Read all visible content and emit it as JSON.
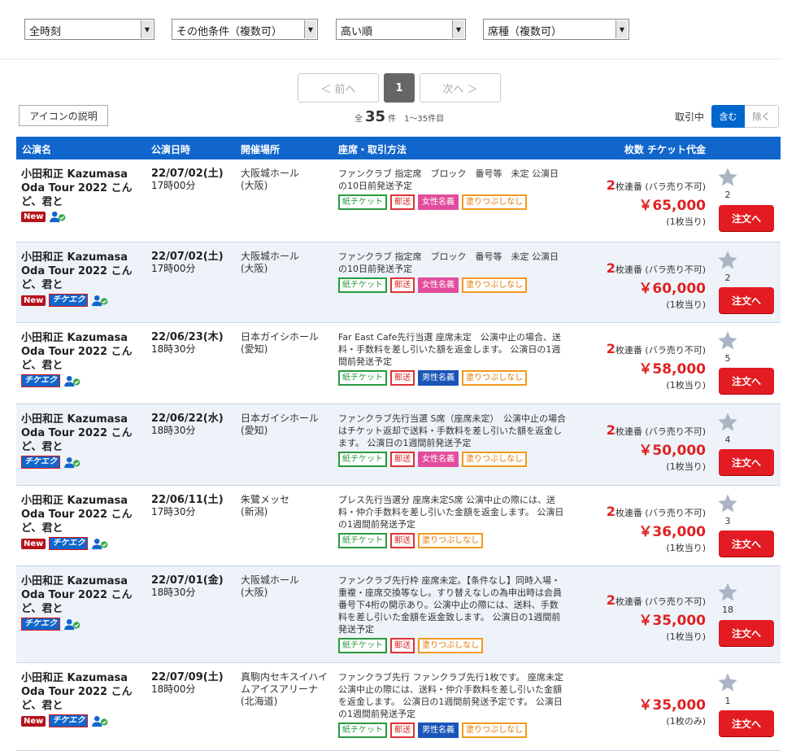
{
  "filters": {
    "time": "全時刻",
    "other": "その他条件（複数可）",
    "sort": "高い順",
    "seat_type": "席種（複数可）"
  },
  "pagination": {
    "prev": "＜ 前へ",
    "current": "1",
    "next": "次へ ＞"
  },
  "icon_legend": "アイコンの説明",
  "result": {
    "total_prefix": "全",
    "total": "35",
    "unit": "件",
    "range": "1〜35件目"
  },
  "trade": {
    "label": "取引中",
    "include": "含む",
    "exclude": "除く"
  },
  "columns": {
    "name": "公演名",
    "date": "公演日時",
    "venue": "開催場所",
    "seat": "座席・取引方法",
    "price": "枚数 チケット代金"
  },
  "colors": {
    "header": "#1166cc",
    "accent": "#e31b22",
    "new_badge": "#b5121b"
  },
  "rows": [
    {
      "name": "小田和正 Kazumasa Oda Tour 2022 こんど、君と",
      "new_badge": "New",
      "checkeq_badge": "",
      "date": "22/07/02(土)",
      "time": "17時00分",
      "venue": "大阪城ホール",
      "region": "(大阪)",
      "desc": "ファンクラブ 指定席　ブロック　番号等　未定 公演日の10日前発送予定",
      "tag1": "紙チケット",
      "tag2": "郵送",
      "tag3": "女性名義",
      "tag4": "塗りつぶしなし",
      "qty_num": "2",
      "qty_text": "枚連番 (バラ売り不可)",
      "price": "￥65,000",
      "per": "(1枚当り)",
      "fav": "2",
      "order": "注文へ"
    },
    {
      "name": "小田和正 Kazumasa Oda Tour 2022 こんど、君と",
      "new_badge": "New",
      "checkeq_badge": "チケエク",
      "date": "22/07/02(土)",
      "time": "17時00分",
      "venue": "大阪城ホール",
      "region": "(大阪)",
      "desc": "ファンクラブ 指定席　ブロック　番号等　未定 公演日の10日前発送予定",
      "tag1": "紙チケット",
      "tag2": "郵送",
      "tag3": "女性名義",
      "tag4": "塗りつぶしなし",
      "qty_num": "2",
      "qty_text": "枚連番 (バラ売り不可)",
      "price": "￥60,000",
      "per": "(1枚当り)",
      "fav": "2",
      "order": "注文へ"
    },
    {
      "name": "小田和正 Kazumasa Oda Tour 2022 こんど、君と",
      "new_badge": "",
      "checkeq_badge": "チケエク",
      "date": "22/06/23(木)",
      "time": "18時30分",
      "venue": "日本ガイシホール",
      "region": "(愛知)",
      "desc": "Far East Cafe先行当選 座席未定　公演中止の場合、送料・手数料を差し引いた額を返金します。 公演日の1週間前発送予定",
      "tag1": "紙チケット",
      "tag2": "郵送",
      "tag3": "男性名義",
      "tag4": "塗りつぶしなし",
      "qty_num": "2",
      "qty_text": "枚連番 (バラ売り不可)",
      "price": "￥58,000",
      "per": "(1枚当り)",
      "fav": "5",
      "order": "注文へ"
    },
    {
      "name": "小田和正 Kazumasa Oda Tour 2022 こんど、君と",
      "new_badge": "",
      "checkeq_badge": "チケエク",
      "date": "22/06/22(水)",
      "time": "18時30分",
      "venue": "日本ガイシホール",
      "region": "(愛知)",
      "desc": "ファンクラブ先行当選 S席（座席未定）　公演中止の場合はチケット返却で送料・手数料を差し引いた額を返金します。 公演日の1週間前発送予定",
      "tag1": "紙チケット",
      "tag2": "郵送",
      "tag3": "女性名義",
      "tag4": "塗りつぶしなし",
      "qty_num": "2",
      "qty_text": "枚連番 (バラ売り不可)",
      "price": "￥50,000",
      "per": "(1枚当り)",
      "fav": "4",
      "order": "注文へ"
    },
    {
      "name": "小田和正 Kazumasa Oda Tour 2022 こんど、君と",
      "new_badge": "New",
      "checkeq_badge": "チケエク",
      "date": "22/06/11(土)",
      "time": "17時30分",
      "venue": "朱鷺メッセ",
      "region": "(新潟)",
      "desc": "プレス先行当選分 座席未定S席 公演中止の際には、送料・仲介手数料を差し引いた金額を返金します。 公演日の1週間前発送予定",
      "tag1": "紙チケット",
      "tag2": "郵送",
      "tag3": "",
      "tag4": "塗りつぶしなし",
      "qty_num": "2",
      "qty_text": "枚連番 (バラ売り不可)",
      "price": "￥36,000",
      "per": "(1枚当り)",
      "fav": "3",
      "order": "注文へ"
    },
    {
      "name": "小田和正 Kazumasa Oda Tour 2022 こんど、君と",
      "new_badge": "",
      "checkeq_badge": "チケエク",
      "date": "22/07/01(金)",
      "time": "18時30分",
      "venue": "大阪城ホール",
      "region": "(大阪)",
      "desc": "ファンクラブ先行枠 座席未定。【条件なし】同時入場・重複・座席交換等なし。すり替えなしの為申出時は会員番号下4桁の開示あり。公演中止の際には、送料、手数料を差し引いた金額を返金致します。 公演日の1週間前発送予定",
      "tag1": "紙チケット",
      "tag2": "郵送",
      "tag3": "",
      "tag4": "塗りつぶしなし",
      "qty_num": "2",
      "qty_text": "枚連番 (バラ売り不可)",
      "price": "￥35,000",
      "per": "(1枚当り)",
      "fav": "18",
      "order": "注文へ"
    },
    {
      "name": "小田和正 Kazumasa Oda Tour 2022 こんど、君と",
      "new_badge": "New",
      "checkeq_badge": "チケエク",
      "date": "22/07/09(土)",
      "time": "18時00分",
      "venue": "真駒内セキスイハイムアイスアリーナ",
      "region": "(北海道)",
      "desc": "ファンクラブ先行 ファンクラブ先行1枚です。 座席未定　公演中止の際には、送料・仲介手数料を差し引いた金額を返金します。 公演日の1週間前発送予定です。 公演日の1週間前発送予定",
      "tag1": "紙チケット",
      "tag2": "郵送",
      "tag3": "男性名義",
      "tag4": "塗りつぶしなし",
      "qty_num": "",
      "qty_text": "",
      "price": "￥35,000",
      "per": "(1枚のみ)",
      "fav": "1",
      "order": "注文へ"
    }
  ]
}
